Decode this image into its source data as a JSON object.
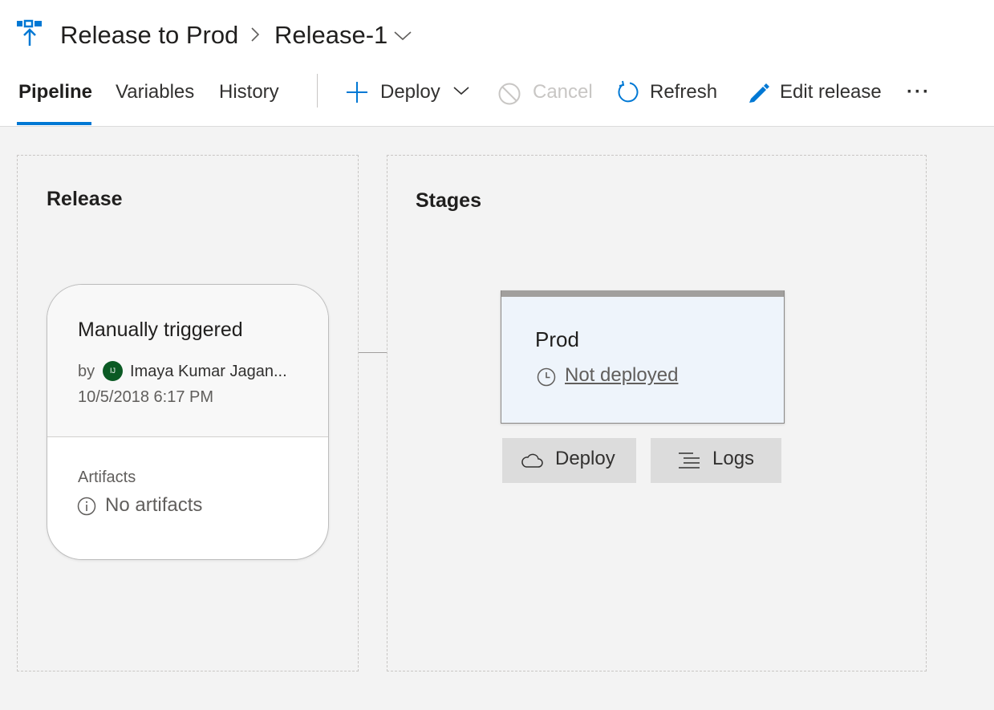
{
  "header": {
    "pipeline_name": "Release to Prod",
    "release_name": "Release-1"
  },
  "tabs": [
    {
      "label": "Pipeline",
      "active": true
    },
    {
      "label": "Variables",
      "active": false
    },
    {
      "label": "History",
      "active": false
    }
  ],
  "toolbar": {
    "deploy_label": "Deploy",
    "cancel_label": "Cancel",
    "refresh_label": "Refresh",
    "edit_label": "Edit release",
    "more_label": "···"
  },
  "release_panel": {
    "title": "Release",
    "card": {
      "trigger": "Manually triggered",
      "by_label": "by",
      "user_initials": "IJ",
      "user_name": "Imaya Kumar Jagan...",
      "date": "10/5/2018 6:17 PM",
      "artifacts_label": "Artifacts",
      "artifacts_value": "No artifacts"
    }
  },
  "stages_panel": {
    "title": "Stages",
    "stage": {
      "name": "Prod",
      "status": "Not deployed",
      "deploy_label": "Deploy",
      "logs_label": "Logs"
    }
  },
  "colors": {
    "accent": "#0078d4",
    "avatar": "#0b5a24",
    "stage_background": "#eef4fb"
  },
  "icons": [
    "release-pipeline-icon",
    "chevron-right-icon",
    "chevron-down-icon",
    "plus-icon",
    "cancel-icon",
    "refresh-icon",
    "pencil-icon",
    "info-icon",
    "clock-icon",
    "cloud-icon",
    "logs-icon"
  ]
}
